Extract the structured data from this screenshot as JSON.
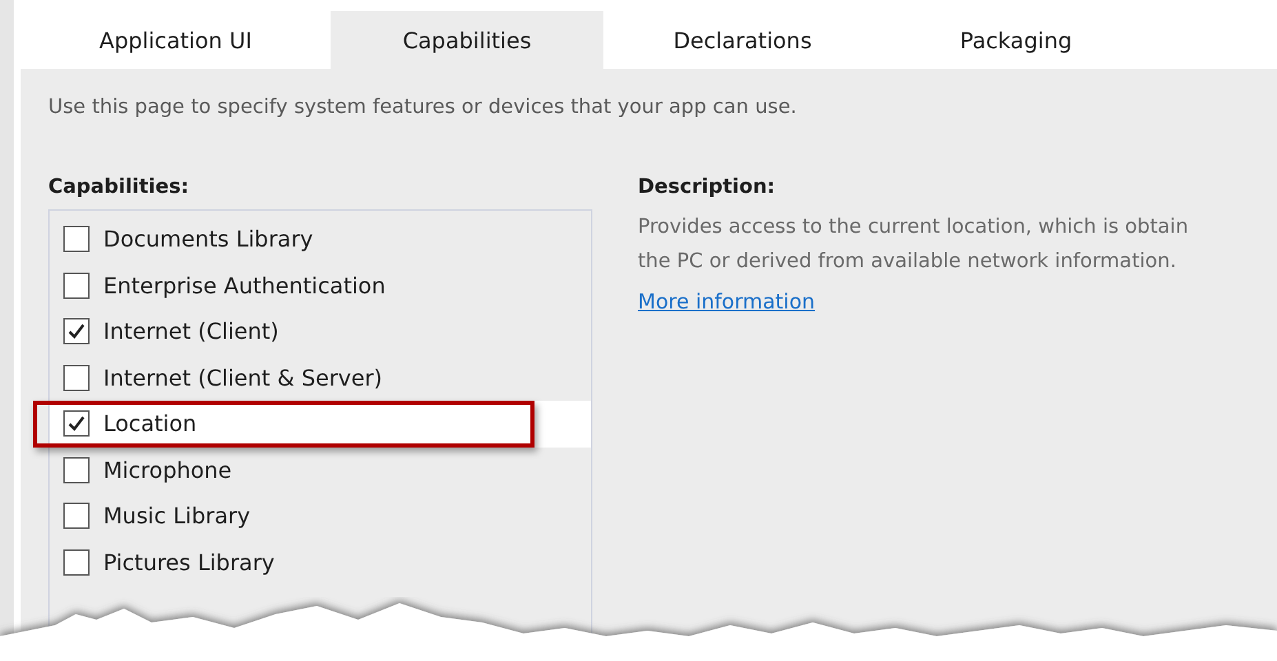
{
  "tabs": [
    {
      "label": "Application UI",
      "selected": false
    },
    {
      "label": "Capabilities",
      "selected": true
    },
    {
      "label": "Declarations",
      "selected": false
    },
    {
      "label": "Packaging",
      "selected": false
    }
  ],
  "intro": "Use this page to specify system features or devices that your app can use.",
  "capabilities": {
    "heading": "Capabilities:",
    "items": [
      {
        "label": "Documents Library",
        "checked": false,
        "selected": false,
        "annotated": false
      },
      {
        "label": "Enterprise Authentication",
        "checked": false,
        "selected": false,
        "annotated": false
      },
      {
        "label": "Internet (Client)",
        "checked": true,
        "selected": false,
        "annotated": false
      },
      {
        "label": "Internet (Client & Server)",
        "checked": false,
        "selected": false,
        "annotated": false
      },
      {
        "label": "Location",
        "checked": true,
        "selected": true,
        "annotated": true
      },
      {
        "label": "Microphone",
        "checked": false,
        "selected": false,
        "annotated": false
      },
      {
        "label": "Music Library",
        "checked": false,
        "selected": false,
        "annotated": false
      },
      {
        "label": "Pictures Library",
        "checked": false,
        "selected": false,
        "annotated": false
      }
    ]
  },
  "description": {
    "heading": "Description:",
    "lines": [
      "Provides access to the current location, which is obtain",
      "the PC or derived from available network information."
    ],
    "link": "More information"
  }
}
